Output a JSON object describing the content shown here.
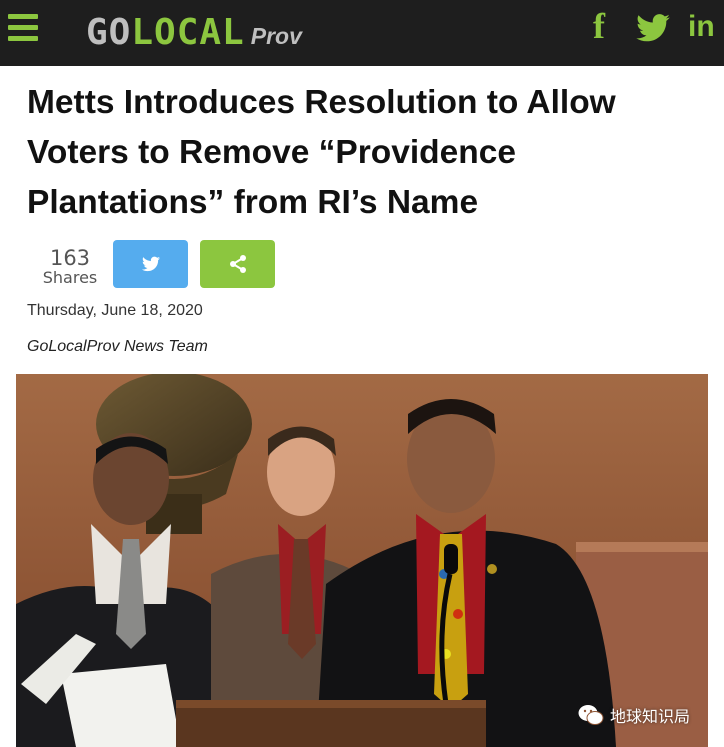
{
  "header": {
    "menu_icon": "hamburger-menu-icon",
    "logo": {
      "go": "GO",
      "local": "LOCAL",
      "prov": "Prov"
    },
    "social": [
      {
        "name": "facebook",
        "label": "f"
      },
      {
        "name": "twitter",
        "label": "twitter-bird-icon"
      },
      {
        "name": "linkedin",
        "label": "in"
      }
    ],
    "colors": {
      "bar": "#1e1e1e",
      "accent": "#8cc63f",
      "logo_gray": "#bfbfbf"
    }
  },
  "article": {
    "headline": "Metts Introduces Resolution to Allow Voters to Remove “Providence Plantations” from RI’s Name",
    "shares": {
      "count": "163",
      "label": "Shares"
    },
    "buttons": {
      "twitter_icon": "twitter-bird-icon",
      "share_icon": "share-icon",
      "twitter_color": "#55acee",
      "share_color": "#8cc63f"
    },
    "date": "Thursday, June 18, 2020",
    "byline": "GoLocalProv News Team"
  },
  "photo": {
    "watermark": "地球知识局"
  }
}
